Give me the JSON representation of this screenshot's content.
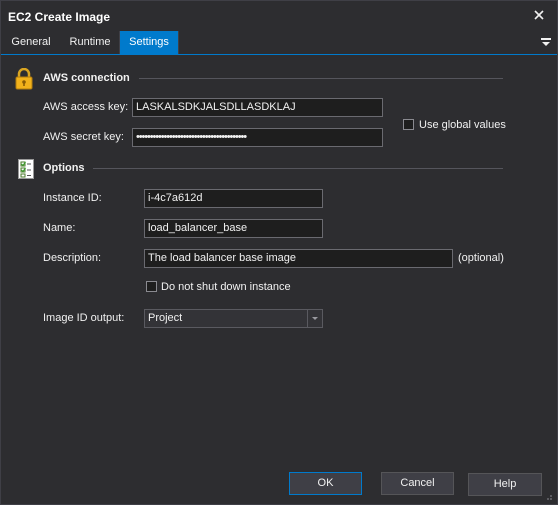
{
  "window": {
    "title": "EC2 Create Image"
  },
  "tabs": [
    {
      "label": "General"
    },
    {
      "label": "Runtime"
    },
    {
      "label": "Settings"
    }
  ],
  "aws_connection": {
    "title": "AWS connection",
    "access_key_label": "AWS access key:",
    "access_key_value": "LASKALSDKJALSDLLASDKLAJ",
    "secret_key_label": "AWS secret key:",
    "secret_key_value": "••••••••••••••••••••••••••••••••••••••••",
    "use_global_label": "Use global values"
  },
  "options": {
    "title": "Options",
    "instance_id_label": "Instance ID:",
    "instance_id_value": "i-4c7a612d",
    "name_label": "Name:",
    "name_value": "load_balancer_base",
    "description_label": "Description:",
    "description_value": "The load balancer base image",
    "description_hint": "(optional)",
    "no_shutdown_label": "Do not shut down instance",
    "image_id_output_label": "Image ID output:",
    "image_id_output_value": "Project"
  },
  "buttons": {
    "ok": "OK",
    "cancel": "Cancel",
    "help": "Help"
  },
  "colors": {
    "accent": "#007acc",
    "background": "#2d2d30"
  }
}
